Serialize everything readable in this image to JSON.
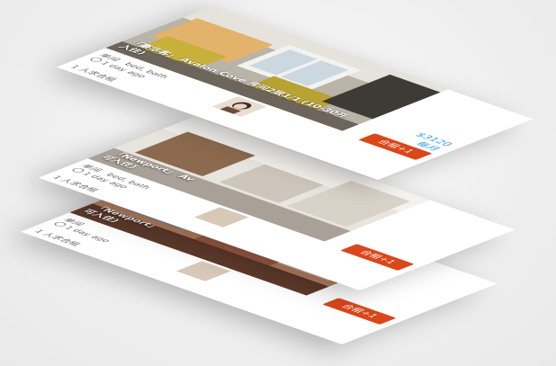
{
  "cards": [
    {
      "caption": "「Newport」",
      "caption2": "可入住)",
      "room": "单间",
      "time": "1 day ago",
      "people": "1 人求合租",
      "join": "合租+1"
    },
    {
      "caption": "「Newport」 Av",
      "caption2": "可入住)",
      "room": "单间",
      "beds": "bed, bath",
      "time": "1 day ago",
      "people": "1 人求合租",
      "join": "合租+1"
    },
    {
      "caption": "「豪华客」 Avalon Cove 房间2层1/1 (10-30开",
      "caption2": "入住)",
      "room": "单间",
      "beds": "bed, bath",
      "time": "1 day ago",
      "people": "1 人求合租",
      "price": "$3120",
      "price_unit": "每月",
      "join": "合租+1"
    }
  ],
  "colors": {
    "accent": "#d9471a",
    "price": "#2b9be0"
  },
  "icons": {
    "clock": "clock-icon"
  }
}
